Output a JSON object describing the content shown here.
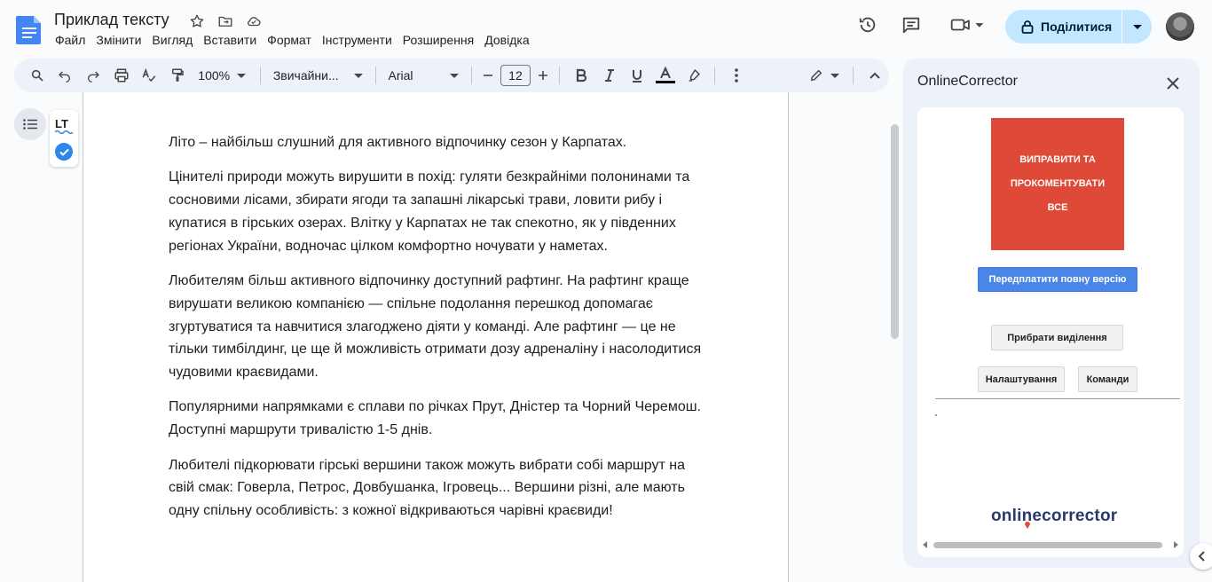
{
  "document": {
    "title": "Приклад тексту",
    "menu": [
      "Файл",
      "Змінити",
      "Вигляд",
      "Вставити",
      "Формат",
      "Інструменти",
      "Розширення",
      "Довідка"
    ],
    "share_label": "Поділитися"
  },
  "toolbar": {
    "zoom": "100%",
    "style": "Звичайни...",
    "font": "Arial",
    "font_size": "12"
  },
  "content": {
    "paragraphs": [
      "Літо – найбільш слушний для активного відпочинку сезон у Карпатах.",
      "Цінителі природи можуть вирушити в похід: гуляти безкрайніми полонинами та сосновими лісами, збирати ягоди та запашні лікарські трави, ловити рибу і купатися в гірських озерах. Влітку у Карпатах не так спекотно, як у південних регіонах України, водночас цілком комфортно ночувати у наметах.",
      "Любителям більш активного відпочинку доступний рафтинг. На рафтинг краще вирушати великою компанією — спільне подолання перешкод допомагає згуртуватися та навчитися злагоджено діяти у команді. Але рафтинг — це не тільки тимбілдинг, це ще й можливість отримати дозу адреналіну і насолодитися чудовими краєвидами.",
      "Популярними напрямками є сплави по річках Прут, Дністер та Чорний Черемош. Доступні маршрути тривалістю 1-5 днів.",
      "Любителі підкорювати гірські вершини також можуть вибрати собі маршрут на свій смак: Говерла, Петрос, Довбушанка, Ігровець... Вершини різні, але мають одну спільну особливість: з кожної відкриваються чарівні краєвиди!"
    ]
  },
  "panel": {
    "title": "OnlineCorrector",
    "fix_all_label": "ВИПРАВИТИ ТА ПРОКОМЕНТУВАТИ ВСЕ",
    "buy_label": "Передплатити повну версію",
    "clear_label": "Прибрати виділення",
    "settings_label": "Налаштування",
    "commands_label": "Команди",
    "brand": "onlinecorrector"
  },
  "widgets": {
    "lt_logo": "LT"
  },
  "colors": {
    "fix_all_bg": "#df4a38",
    "buy_bg": "#4a86e8",
    "share_bg": "#c2e7ff",
    "brand_text": "#2b3a6b"
  }
}
